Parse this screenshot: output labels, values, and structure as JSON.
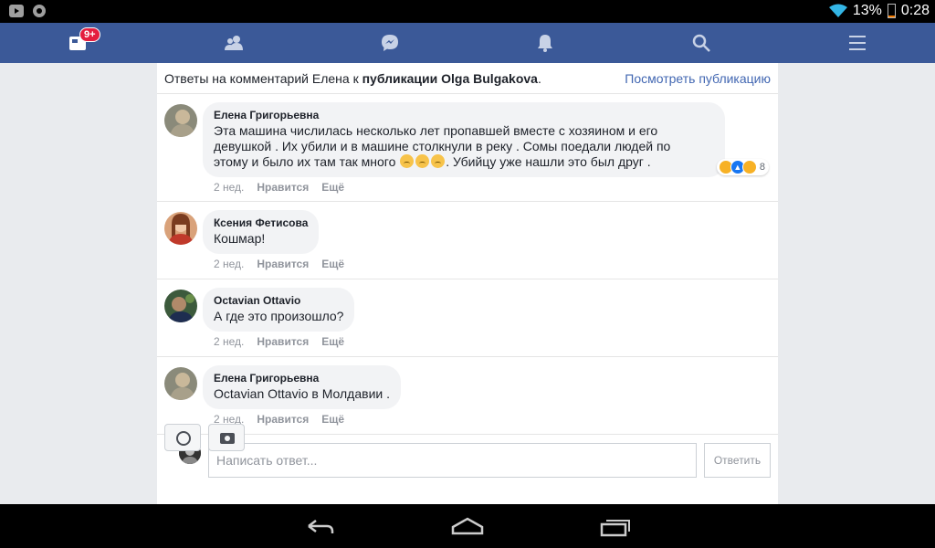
{
  "status_bar": {
    "battery_percent": "13%",
    "time": "0:28",
    "icons": [
      "youtube-icon",
      "chrome-icon",
      "wifi-icon",
      "battery-icon"
    ]
  },
  "top_nav": {
    "notification_badge": "9+",
    "items": [
      "news-feed-icon",
      "friends-icon",
      "messenger-icon",
      "notifications-icon",
      "search-icon",
      "menu-icon"
    ]
  },
  "header": {
    "prefix": "Ответы на комментарий Елена к ",
    "post_link": "публикации Olga Bulgakova",
    "suffix": ".",
    "view_post": "Посмотреть публикацию"
  },
  "comments": [
    {
      "author": "Елена Григорьевна",
      "text_1": "Эта машина числилась несколько лет пропавшей вместе с хозяином и его",
      "text_2": "девушкой . Их убили и в машине столкнули в реку . Сомы поедали людей по",
      "text_3a": "этому и было их там так много ",
      "text_3b": ". Убийцу уже нашли это был друг .",
      "time": "2 нед.",
      "like": "Нравится",
      "more": "Ещё",
      "reaction_count": "8"
    },
    {
      "author": "Ксения Фетисова",
      "text": "Кошмар!",
      "time": "2 нед.",
      "like": "Нравится",
      "more": "Ещё"
    },
    {
      "author": "Octavian Ottavio",
      "text": "А где это произошло?",
      "time": "2 нед.",
      "like": "Нравится",
      "more": "Ещё"
    },
    {
      "author": "Елена Григорьевна",
      "text": "Octavian Ottavio в Молдавии .",
      "time": "2 нед.",
      "like": "Нравится",
      "more": "Ещё"
    }
  ],
  "reply": {
    "placeholder": "Написать ответ...",
    "button": "Ответить"
  },
  "colors": {
    "brand": "#3b5998",
    "link": "#4267b2",
    "badge": "#e41e3f"
  }
}
